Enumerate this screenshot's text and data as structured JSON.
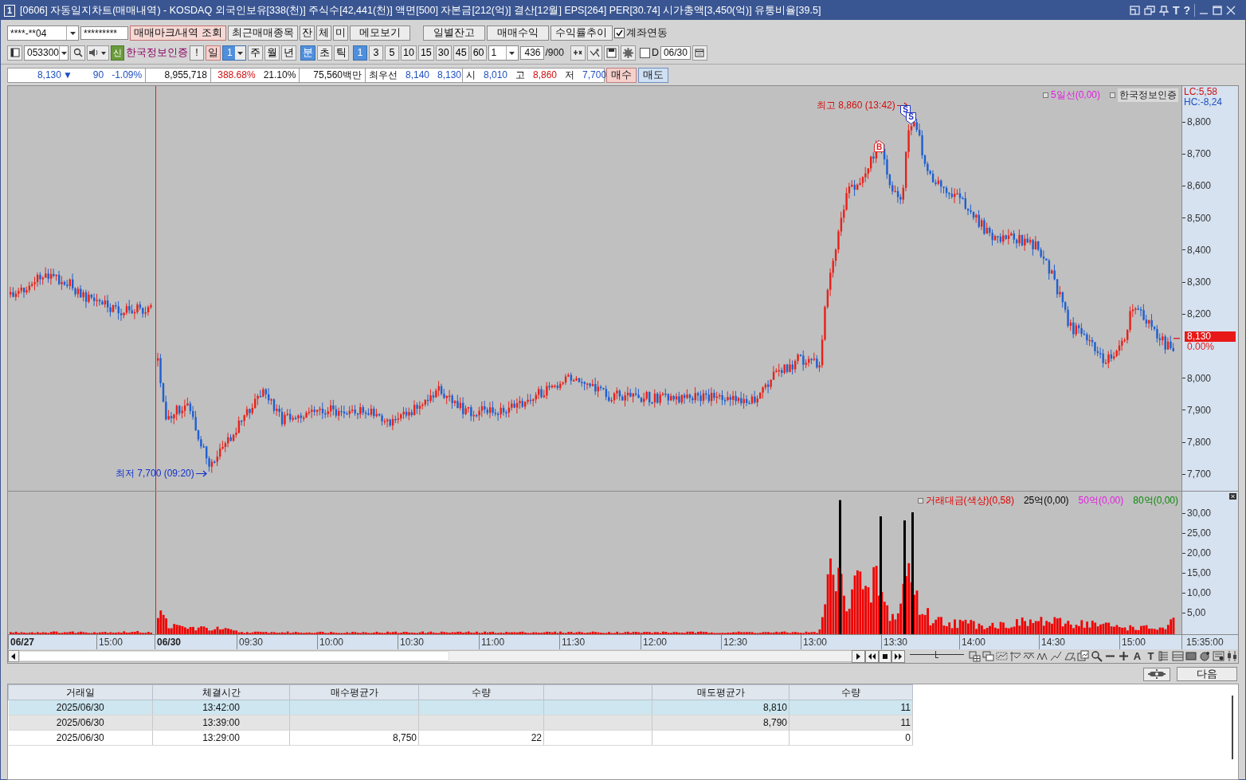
{
  "title_bar": {
    "window_number": "1",
    "title": "[0606] 자동일지차트(매매내역) - KOSDAQ 외국인보유[338(천)] 주식수[42,441(천)] 액면[500] 자본금[212(억)] 결산[12월] EPS[264] PER[30.74] 시가총액[3,450(억)] 유통비율[39.5]",
    "tool_letters": [
      "T",
      "?"
    ]
  },
  "account_bar": {
    "account": "****-**04",
    "password": "*********",
    "buttons": [
      {
        "label": "매매마크/내역 조회",
        "selected": true
      },
      {
        "label": "최근매매종목",
        "selected": false
      },
      {
        "label": "잔",
        "selected": false
      },
      {
        "label": "체",
        "selected": false
      },
      {
        "label": "미",
        "selected": false
      },
      {
        "label": "메모보기",
        "selected": false
      }
    ],
    "report_buttons": [
      "일별잔고",
      "매매수익",
      "수익률추이"
    ],
    "link_checkbox": {
      "label": "계좌연동",
      "checked": true
    }
  },
  "symbol_bar": {
    "code": "053300",
    "market_badge": "신",
    "name": "한국정보인증",
    "alert_button": "!",
    "day_button": "일",
    "day_count": "1",
    "period_tabs": [
      {
        "label": "주",
        "selected": false
      },
      {
        "label": "월",
        "selected": false
      },
      {
        "label": "년",
        "selected": false
      },
      {
        "label": "분",
        "selected": true
      },
      {
        "label": "초",
        "selected": false
      },
      {
        "label": "틱",
        "selected": false
      }
    ],
    "intervals": [
      {
        "label": "1",
        "selected": true
      },
      {
        "label": "3",
        "selected": false
      },
      {
        "label": "5",
        "selected": false
      },
      {
        "label": "10",
        "selected": false
      },
      {
        "label": "15",
        "selected": false
      },
      {
        "label": "30",
        "selected": false
      },
      {
        "label": "45",
        "selected": false
      },
      {
        "label": "60",
        "selected": false
      }
    ],
    "interval_select": "1",
    "bar_count": "436",
    "bar_total": "/900",
    "date_checkbox": {
      "label": "D",
      "checked": false
    },
    "date": "06/30"
  },
  "quote_bar": {
    "groups": [
      [
        {
          "text": "8,130",
          "color": "#1f4fc0"
        },
        {
          "text": "▼",
          "color": "#1f4fc0"
        },
        {
          "text": "90",
          "color": "#1f4fc0"
        },
        {
          "text": "-1.09%",
          "color": "#1f4fc0"
        }
      ],
      [
        {
          "text": "8,955,718"
        }
      ],
      [
        {
          "text": "388.68%",
          "color": "#d01010"
        },
        {
          "text": "21.10%"
        }
      ],
      [
        {
          "text": "75,560백만"
        }
      ],
      [
        {
          "text": "최우선"
        },
        {
          "text": "8,140",
          "color": "#1f4fc0"
        },
        {
          "text": "8,130",
          "color": "#1f4fc0"
        }
      ],
      [
        {
          "text": "시"
        },
        {
          "text": "8,010",
          "color": "#1f4fc0"
        },
        {
          "text": "고"
        },
        {
          "text": "8,860",
          "color": "#d01010"
        },
        {
          "text": "저"
        },
        {
          "text": "7,700",
          "color": "#1f4fc0"
        }
      ]
    ],
    "buttons": [
      {
        "label": "매수",
        "kind": "buy"
      },
      {
        "label": "매도",
        "kind": "sell"
      }
    ]
  },
  "price_chart": {
    "legend": [
      {
        "text": "5일선(0,00)",
        "color": "#e020e0"
      },
      {
        "text": "한국정보인증",
        "color": "#222222"
      }
    ],
    "lc": "LC:5,58",
    "hc": "HC:-8,24",
    "yticks": [
      "8,800",
      "8,700",
      "8,600",
      "8,500",
      "8,400",
      "8,300",
      "8,200",
      "8,000",
      "7,900",
      "7,800",
      "7,700"
    ],
    "last_price": "8,130",
    "last_change": "0.00%",
    "high_note": "최고 8,860 (13:42)",
    "low_note": "최저 7,700 (09:20)",
    "trade_marks": [
      {
        "label": "B",
        "kind": "buy"
      },
      {
        "label": "S",
        "kind": "sell"
      },
      {
        "label": "S",
        "kind": "sell"
      }
    ]
  },
  "volume_chart": {
    "legend": [
      {
        "text": "거래대금(색상)(0,58)",
        "color": "#e00000"
      },
      {
        "text": "25억(0,00)",
        "color": "#000000"
      },
      {
        "text": "50억(0,00)",
        "color": "#e020e0"
      },
      {
        "text": "80억(0,00)",
        "color": "#088a08"
      }
    ],
    "yticks": [
      "30,00",
      "25,00",
      "20,00",
      "15,00",
      "10,00",
      "5,00"
    ]
  },
  "time_axis": {
    "labels": [
      {
        "text": "06/27",
        "kind": "date"
      },
      {
        "text": "15:00",
        "kind": "time"
      },
      {
        "text": "06/30",
        "kind": "date"
      },
      {
        "text": "09:30",
        "kind": "time"
      },
      {
        "text": "10:00",
        "kind": "time"
      },
      {
        "text": "10:30",
        "kind": "time"
      },
      {
        "text": "11:00",
        "kind": "time"
      },
      {
        "text": "11:30",
        "kind": "time"
      },
      {
        "text": "12:00",
        "kind": "time"
      },
      {
        "text": "12:30",
        "kind": "time"
      },
      {
        "text": "13:00",
        "kind": "time"
      },
      {
        "text": "13:30",
        "kind": "time"
      },
      {
        "text": "14:00",
        "kind": "time"
      },
      {
        "text": "14:30",
        "kind": "time"
      },
      {
        "text": "15:00",
        "kind": "time"
      }
    ],
    "end_time": "15:35:00"
  },
  "chart_controls": {
    "zoom_slider": {
      "level": 0.5
    },
    "tool_letters": [
      "A",
      "T"
    ]
  },
  "bottom_bar": {
    "next_button": "다음"
  },
  "trades_table": {
    "columns": [
      {
        "label": "거래일"
      },
      {
        "label": "체결시간"
      },
      {
        "label": "매수평균가"
      },
      {
        "label": "수량"
      },
      {},
      {
        "label": "매도평균가"
      },
      {
        "label": "수량"
      }
    ],
    "rows": [
      {
        "selected": true,
        "date": "2025/06/30",
        "time": "13:42:00",
        "sell_avg": "8,810",
        "sell_qty": "11"
      },
      {
        "selected": false,
        "date": "2025/06/30",
        "time": "13:39:00",
        "sell_avg": "8,790",
        "sell_qty": "11"
      },
      {
        "selected": false,
        "date": "2025/06/30",
        "time": "13:29:00",
        "buy_avg": "8,750",
        "buy_qty": "22",
        "sell_qty": "0"
      }
    ]
  }
}
